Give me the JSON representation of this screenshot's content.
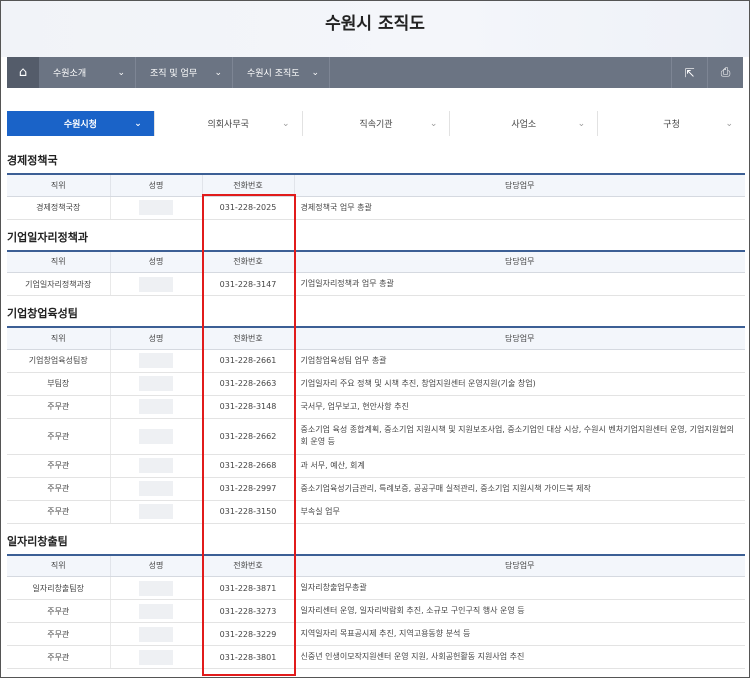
{
  "header": {
    "title": "수원시 조직도"
  },
  "navbar": {
    "home_icon": "home-icon",
    "items": [
      {
        "label": "수원소개"
      },
      {
        "label": "조직 및 업무"
      },
      {
        "label": "수원시 조직도"
      }
    ],
    "share_icon": "share-icon",
    "print_icon": "print-icon"
  },
  "tabs": [
    {
      "label": "수원시청",
      "active": true
    },
    {
      "label": "의회사무국"
    },
    {
      "label": "직속기관"
    },
    {
      "label": "사업소"
    },
    {
      "label": "구청"
    }
  ],
  "columns": {
    "position": "직위",
    "name": "성명",
    "phone": "전화번호",
    "duty": "담당업무"
  },
  "sections": [
    {
      "title": "경제정책국",
      "rows": [
        {
          "position": "경제정책국장",
          "phone": "031-228-2025",
          "duty": "경제정책국 업무 총괄"
        }
      ]
    },
    {
      "title": "기업일자리정책과",
      "rows": [
        {
          "position": "기업일자리정책과장",
          "phone": "031-228-3147",
          "duty": "기업일자리정책과 업무 총괄"
        }
      ]
    },
    {
      "title": "기업창업육성팀",
      "rows": [
        {
          "position": "기업창업육성팀장",
          "phone": "031-228-2661",
          "duty": "기업창업육성팀 업무 총괄"
        },
        {
          "position": "부팀장",
          "phone": "031-228-2663",
          "duty": "기업일자리 주요 정책 및 시책 추진, 창업지원센터 운영지원(기술 창업)"
        },
        {
          "position": "주무관",
          "phone": "031-228-3148",
          "duty": "국서무, 업무보고, 현안사항 추진"
        },
        {
          "position": "주무관",
          "phone": "031-228-2662",
          "duty": "중소기업 육성 종합계획, 중소기업 지원시책 및 지원보조사업, 중소기업인 대상 시상, 수원시 벤처기업지원센터 운영, 기업지원협의회 운영 등"
        },
        {
          "position": "주무관",
          "phone": "031-228-2668",
          "duty": "과 서무, 예산, 회계"
        },
        {
          "position": "주무관",
          "phone": "031-228-2997",
          "duty": "중소기업육성기금관리, 특례보증, 공공구매 실적관리, 중소기업 지원시책 가이드북 제작"
        },
        {
          "position": "주무관",
          "phone": "031-228-3150",
          "duty": "부속실 업무"
        }
      ]
    },
    {
      "title": "일자리창출팀",
      "rows": [
        {
          "position": "일자리창출팀장",
          "phone": "031-228-3871",
          "duty": "일자리창출업무총괄"
        },
        {
          "position": "주무관",
          "phone": "031-228-3273",
          "duty": "일자리센터 운영, 일자리박람회 추진, 소규모 구인구직 행사 운영 등"
        },
        {
          "position": "주무관",
          "phone": "031-228-3229",
          "duty": "지역일자리 목표공시제 추진, 지역고용동향 분석 등"
        },
        {
          "position": "주무관",
          "phone": "031-228-3801",
          "duty": "신중년 인생이모작지원센터 운영 지원, 사회공헌활동 지원사업 추진"
        }
      ]
    }
  ],
  "colors": {
    "accent": "#1a63c8",
    "nav": "#6b7483",
    "highlight": "#e11b1b"
  }
}
